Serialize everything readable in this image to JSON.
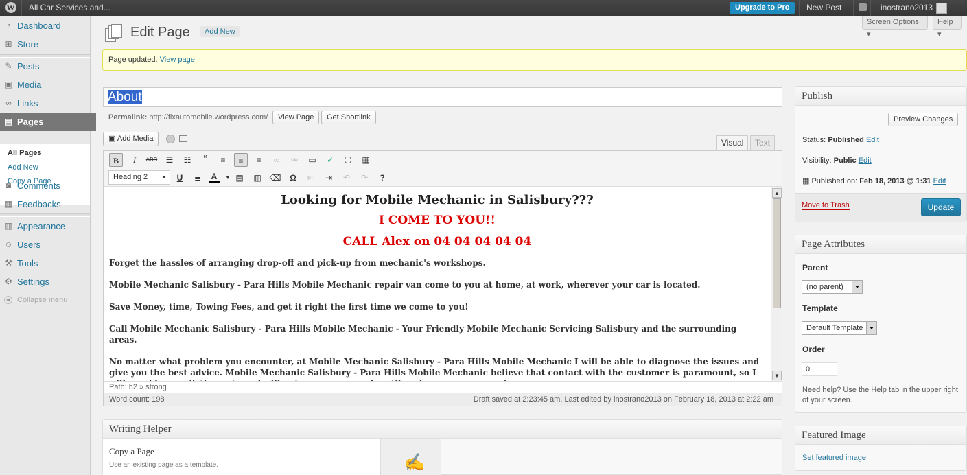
{
  "admin_bar": {
    "site_name": "All Car Services and...",
    "upgrade_label": "Upgrade to Pro",
    "new_post_label": "New Post",
    "username": "inostrano2013"
  },
  "top_buttons": {
    "screen_options": "Screen Options",
    "help": "Help"
  },
  "menu": {
    "items": [
      {
        "label": "Dashboard",
        "icon": "dashboard-icon"
      },
      {
        "label": "Store",
        "icon": "cart-icon"
      },
      {
        "label": "Posts",
        "icon": "pushpin-icon"
      },
      {
        "label": "Media",
        "icon": "media-icon"
      },
      {
        "label": "Links",
        "icon": "link-icon"
      },
      {
        "label": "Pages",
        "icon": "page-icon"
      },
      {
        "label": "Comments",
        "icon": "comment-icon"
      },
      {
        "label": "Feedbacks",
        "icon": "feedback-icon"
      },
      {
        "label": "Appearance",
        "icon": "appearance-icon"
      },
      {
        "label": "Users",
        "icon": "users-icon"
      },
      {
        "label": "Tools",
        "icon": "tools-icon"
      },
      {
        "label": "Settings",
        "icon": "settings-icon"
      }
    ],
    "submenu": [
      "All Pages",
      "Add New",
      "Copy a Page"
    ],
    "collapse": "Collapse menu"
  },
  "page": {
    "heading": "Edit Page",
    "add_new": "Add New",
    "notice_text": "Page updated.",
    "notice_link": "View page",
    "title_value": "About",
    "permalink_label": "Permalink:",
    "permalink_url": "http://fixautomobile.wordpress.com/",
    "view_page_btn": "View Page",
    "shortlink_btn": "Get Shortlink",
    "add_media": "Add Media"
  },
  "editor": {
    "tab_visual": "Visual",
    "tab_text": "Text",
    "format_select": "Heading 2",
    "heading1": "Looking for Mobile Mechanic in Salisbury???",
    "heading2": "I COME TO YOU!!",
    "heading3": "CALL Alex on 04 04 04 04 04",
    "paragraphs": [
      "Forget the hassles of arranging drop-off and pick-up from mechanic's workshops.",
      "Mobile Mechanic Salisbury - Para Hills Mobile Mechanic repair van come to you at home, at work, wherever your car is located.",
      "Save Money, time, Towing Fees, and get it right the first time we come to you!",
      "Call Mobile Mechanic Salisbury - Para Hills Mobile Mechanic - Your Friendly Mobile Mechanic Servicing Salisbury and the surrounding areas.",
      "No matter what problem you encounter, at Mobile Mechanic Salisbury - Para Hills Mobile Mechanic I will be able to diagnose the issues and give you the best advice. Mobile Mechanic Salisbury - Para Hills Mobile Mechanic believe that contact with the customer is paramount, so I will provide a realistic quote and will not commence work until we have your approval."
    ],
    "path": "Path: h2 » strong",
    "word_count": "Word count: 198",
    "draft_status": "Draft saved at 2:23:45 am. Last edited by inostrano2013 on February 18, 2013 at 2:22 am"
  },
  "publish": {
    "title": "Publish",
    "preview": "Preview Changes",
    "status_label": "Status:",
    "status_value": "Published",
    "visibility_label": "Visibility:",
    "visibility_value": "Public",
    "published_label": "Published on:",
    "published_value": "Feb 18, 2013 @ 1:31",
    "edit": "Edit",
    "trash": "Move to Trash",
    "update": "Update"
  },
  "attributes": {
    "title": "Page Attributes",
    "parent_label": "Parent",
    "parent_value": "(no parent)",
    "template_label": "Template",
    "template_value": "Default Template",
    "order_label": "Order",
    "order_value": "0",
    "help_text": "Need help? Use the Help tab in the upper right of your screen."
  },
  "featured": {
    "title": "Featured Image",
    "link": "Set featured image"
  },
  "writing_helper": {
    "title": "Writing Helper",
    "item_title": "Copy a Page",
    "item_desc": "Use an existing page as a template."
  },
  "colors": {
    "accent": "#21759b",
    "update_button": "#2a95c5",
    "heading_red": "#dd0000"
  }
}
